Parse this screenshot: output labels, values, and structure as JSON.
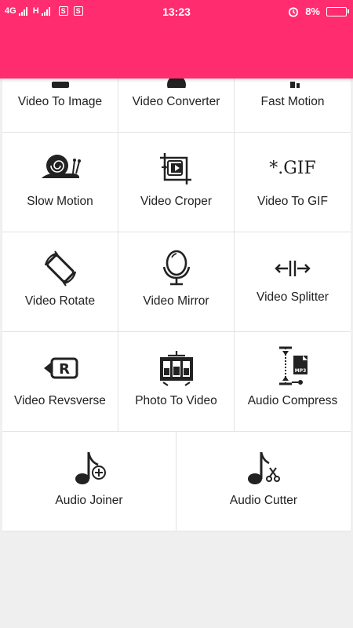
{
  "status_bar": {
    "network_1": "4G",
    "network_2": "H",
    "sim_1": "S",
    "sim_2": "S",
    "time": "13:23",
    "battery": "8%",
    "icons": [
      "signal-icon",
      "alarm-icon",
      "battery-icon"
    ]
  },
  "header": {
    "color": "#ff2d6f"
  },
  "tools": [
    {
      "label": "Video To Image",
      "icon": "video-to-image-icon"
    },
    {
      "label": "Video Converter",
      "icon": "video-converter-icon"
    },
    {
      "label": "Fast Motion",
      "icon": "fast-motion-icon"
    },
    {
      "label": "Slow Motion",
      "icon": "snail-icon"
    },
    {
      "label": "Video Croper",
      "icon": "crop-icon"
    },
    {
      "label": "Video To GIF",
      "icon": "gif-icon",
      "icon_text": "*.GIF"
    },
    {
      "label": "Video Rotate",
      "icon": "rotate-icon"
    },
    {
      "label": "Video Mirror",
      "icon": "mirror-icon"
    },
    {
      "label": "Video Splitter",
      "icon": "splitter-icon"
    },
    {
      "label": "Video Revsverse",
      "icon": "reverse-icon",
      "icon_text": "R"
    },
    {
      "label": "Photo To Video",
      "icon": "film-strip-icon"
    },
    {
      "label": "Audio Compress",
      "icon": "compress-icon",
      "icon_text": "MP3"
    },
    {
      "label": "Audio Joiner",
      "icon": "music-plus-icon"
    },
    {
      "label": "Audio Cutter",
      "icon": "music-scissors-icon"
    }
  ]
}
